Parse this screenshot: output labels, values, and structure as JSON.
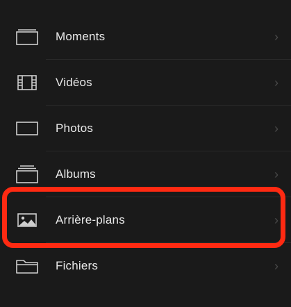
{
  "menu": {
    "items": [
      {
        "label": "Moments",
        "icon": "moments-icon",
        "chevron": "›"
      },
      {
        "label": "Vidéos",
        "icon": "film-icon",
        "chevron": "›"
      },
      {
        "label": "Photos",
        "icon": "photo-frame-icon",
        "chevron": "›"
      },
      {
        "label": "Albums",
        "icon": "albums-icon",
        "chevron": "›"
      },
      {
        "label": "Arrière-plans",
        "icon": "wallpaper-icon",
        "chevron": "›"
      },
      {
        "label": "Fichiers",
        "icon": "folder-icon",
        "chevron": "›"
      }
    ]
  },
  "colors": {
    "background": "#1a1a1a",
    "text": "#e9e9e9",
    "highlight": "#ff2a12"
  }
}
